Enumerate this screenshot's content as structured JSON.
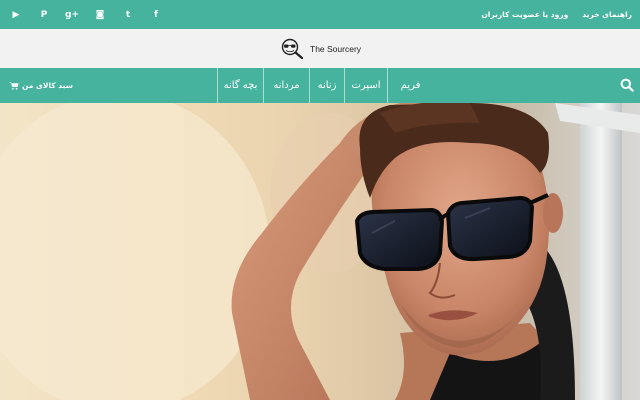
{
  "topbar": {
    "social": [
      {
        "name": "youtube",
        "glyph": "▶"
      },
      {
        "name": "pinterest",
        "glyph": "P"
      },
      {
        "name": "google-plus",
        "glyph": "g+"
      },
      {
        "name": "instagram",
        "glyph": "◙"
      },
      {
        "name": "twitter",
        "glyph": "t"
      },
      {
        "name": "facebook",
        "glyph": "f"
      }
    ],
    "links": {
      "buy_guide": "راهنمای خرید",
      "login_register": "ورود یا عضویت کاربران"
    }
  },
  "logo": {
    "text": "The Sourcery"
  },
  "nav": {
    "cart_label": "سبد کالای من",
    "items": [
      {
        "label": "فریم"
      },
      {
        "label": "اسپرت"
      },
      {
        "label": "زنانه"
      },
      {
        "label": "مردانه"
      },
      {
        "label": "بچه گانه"
      }
    ]
  },
  "colors": {
    "brand_green": "#45b39d",
    "logo_band": "#f2f2f2"
  }
}
